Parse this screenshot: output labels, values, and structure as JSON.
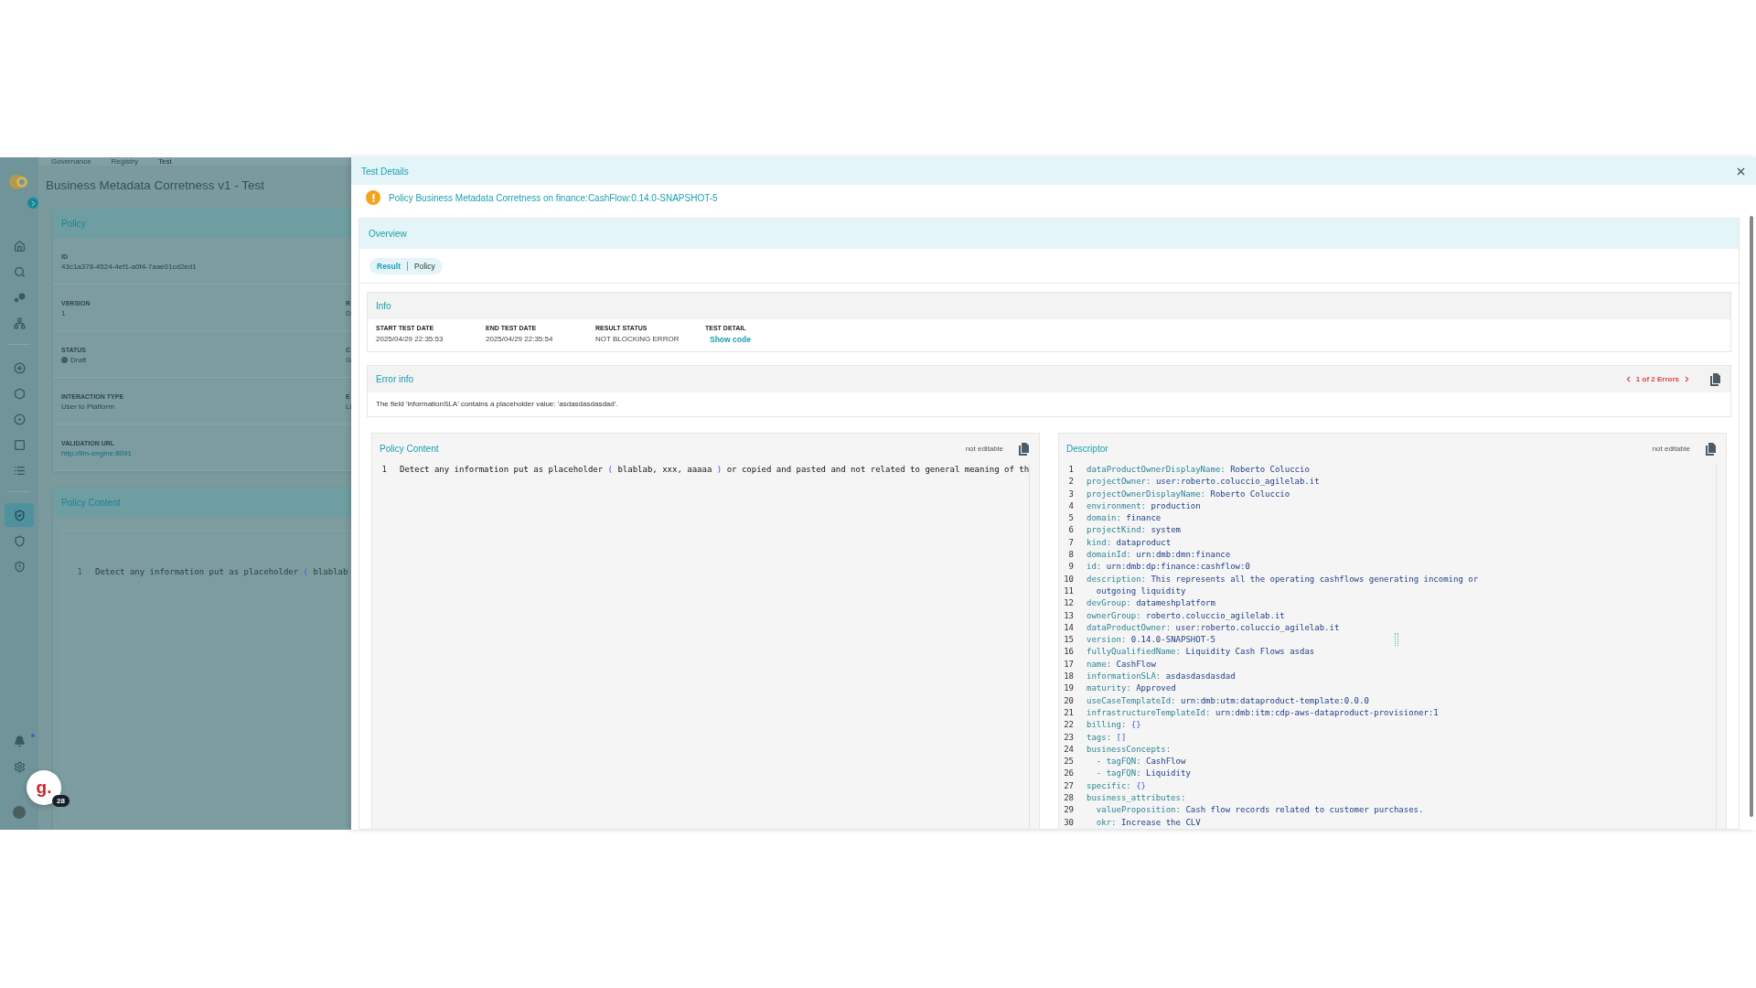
{
  "background_page": {
    "breadcrumbs": [
      "Governance",
      "Registry",
      "Test"
    ],
    "title": "Business Metadata Corretness v1 - Test",
    "policy_card": {
      "title": "Policy",
      "fields": [
        {
          "label": "ID",
          "value": "43c1a378-4524-4ef1-a0f4-7aae01cd2ed1",
          "kind": "text"
        },
        {
          "label": "VERSION",
          "value": "1",
          "kind": "text",
          "column_2_label": "R",
          "column_2_value": "D"
        },
        {
          "label": "STATUS",
          "value": "Draft",
          "kind": "status",
          "column_2_label": "C",
          "column_2_value": "G"
        },
        {
          "label": "INTERACTION TYPE",
          "value": "User to Platform",
          "kind": "text",
          "column_2_label": "E",
          "column_2_value": "Li"
        },
        {
          "label": "VALIDATION URL",
          "value": "http://llm-engine:8091",
          "kind": "link"
        }
      ]
    },
    "content_card": {
      "title": "Policy Content",
      "line_number": "1",
      "segments": [
        {
          "text": "Detect any information put as placeholder ",
          "kind": "text"
        },
        {
          "text": "(",
          "kind": "paren"
        },
        {
          "text": " blablab",
          "kind": "text"
        }
      ]
    }
  },
  "sidebar": {
    "items": [
      {
        "kind": "home",
        "selected": false
      },
      {
        "kind": "search",
        "selected": false
      },
      {
        "kind": "dots",
        "selected": false
      },
      {
        "kind": "network",
        "selected": false
      },
      {
        "kind": "hexagon-plus",
        "selected": false
      },
      {
        "kind": "hexagon",
        "selected": false
      },
      {
        "kind": "circle-dot",
        "selected": false
      },
      {
        "kind": "square",
        "selected": false
      },
      {
        "kind": "list",
        "selected": false
      },
      {
        "kind": "shield-check",
        "selected": true
      },
      {
        "kind": "shield",
        "selected": false
      },
      {
        "kind": "shield-alert",
        "selected": false
      }
    ]
  },
  "floating_badge": {
    "letter": "g.",
    "count": "28"
  },
  "drawer": {
    "title": "Test Details",
    "alert": "Policy Business Metadata Corretness on finance:CashFlow:0.14.0-SNAPSHOT-5",
    "overview": {
      "title": "Overview",
      "tabs": [
        {
          "label": "Result",
          "selected": true
        },
        {
          "label": "Policy",
          "selected": false
        }
      ]
    },
    "info": {
      "title": "Info",
      "columns": [
        {
          "label": "START TEST DATE",
          "value": "2025/04/29 22:35:53",
          "kind": "text"
        },
        {
          "label": "END TEST DATE",
          "value": "2025/04/29 22:35:54",
          "kind": "text"
        },
        {
          "label": "RESULT STATUS",
          "value": "NOT BLOCKING ERROR",
          "kind": "text"
        },
        {
          "label": "TEST DETAIL",
          "value": "Show code",
          "kind": "link"
        }
      ]
    },
    "error_info": {
      "title": "Error info",
      "pager": "1 of 2 Errors",
      "message": "The field 'informationSLA' contains a placeholder value: 'asdasdasdasdad'."
    },
    "policy_content": {
      "title": "Policy Content",
      "badge": "not editable",
      "lines": [
        {
          "number": "1",
          "segments": [
            {
              "text": "Detect any information put as placeholder ",
              "kind": "text"
            },
            {
              "text": "(",
              "kind": "paren"
            },
            {
              "text": " blablab, xxx, aaaaa ",
              "kind": "text"
            },
            {
              "text": ")",
              "kind": "paren"
            },
            {
              "text": " or copied and pasted and not related to general meaning of th",
              "kind": "text"
            }
          ]
        }
      ]
    },
    "descriptor": {
      "title": "Descriptor",
      "badge": "not editable",
      "lines": [
        {
          "number": "1",
          "key": "dataProductOwnerDisplayName:",
          "value": "Roberto Coluccio",
          "kind": "text"
        },
        {
          "number": "2",
          "key": "projectOwner:",
          "value": "user:roberto.coluccio_agilelab.it",
          "kind": "text"
        },
        {
          "number": "3",
          "key": "projectOwnerDisplayName:",
          "value": "Roberto Coluccio",
          "kind": "text"
        },
        {
          "number": "4",
          "key": "environment:",
          "value": "production",
          "kind": "text"
        },
        {
          "number": "5",
          "key": "domain:",
          "value": "finance",
          "kind": "text"
        },
        {
          "number": "6",
          "key": "projectKind:",
          "value": "system",
          "kind": "text"
        },
        {
          "number": "7",
          "key": "kind:",
          "value": "dataproduct",
          "kind": "text"
        },
        {
          "number": "8",
          "key": "domainId:",
          "value": "urn:dmb:dmn:finance",
          "kind": "text"
        },
        {
          "number": "9",
          "key": "id:",
          "value": "urn:dmb:dp:finance:cashflow:0",
          "kind": "text"
        },
        {
          "number": "10",
          "key": "description:",
          "value": "This represents all the operating cashflows generating incoming or",
          "kind": "text"
        },
        {
          "number": "11",
          "value": "  outgoing liquidity",
          "kind": "text"
        },
        {
          "number": "12",
          "key": "devGroup:",
          "value": "datameshplatform",
          "kind": "text"
        },
        {
          "number": "13",
          "key": "ownerGroup:",
          "value": "roberto.coluccio_agilelab.it",
          "kind": "text"
        },
        {
          "number": "14",
          "key": "dataProductOwner:",
          "value": "user:roberto.coluccio_agilelab.it",
          "kind": "text"
        },
        {
          "number": "15",
          "key": "version:",
          "value": "0.14.0-SNAPSHOT-5",
          "kind": "text"
        },
        {
          "number": "16",
          "key": "fullyQualifiedName:",
          "value": "Liquidity Cash Flows asdas",
          "kind": "text"
        },
        {
          "number": "17",
          "key": "name:",
          "value": "CashFlow",
          "kind": "text"
        },
        {
          "number": "18",
          "key": "informationSLA:",
          "value": "asdasdasdasdad",
          "kind": "text"
        },
        {
          "number": "19",
          "key": "maturity:",
          "value": "Approved",
          "kind": "text"
        },
        {
          "number": "20",
          "key": "useCaseTemplateId:",
          "value": "urn:dmb:utm:dataproduct-template:0.0.0",
          "kind": "text"
        },
        {
          "number": "21",
          "key": "infrastructureTemplateId:",
          "value": "urn:dmb:itm:cdp-aws-dataproduct-provisioner:1",
          "kind": "text"
        },
        {
          "number": "22",
          "key": "billing:",
          "value": "{}",
          "kind": "bracket"
        },
        {
          "number": "23",
          "key": "tags:",
          "value": "[]",
          "kind": "bracket"
        },
        {
          "number": "24",
          "key": "businessConcepts:"
        },
        {
          "number": "25",
          "key": "  - tagFQN:",
          "value": "CashFlow",
          "kind": "text"
        },
        {
          "number": "26",
          "key": "  - tagFQN:",
          "value": "Liquidity",
          "kind": "text"
        },
        {
          "number": "27",
          "key": "specific:",
          "value": "{}",
          "kind": "bracket"
        },
        {
          "number": "28",
          "key": "business_attributes:"
        },
        {
          "number": "29",
          "key": "  valueProposition:",
          "value": "Cash flow records related to customer purchases.",
          "kind": "text"
        },
        {
          "number": "30",
          "key": "  okr:",
          "value": "Increase the CLV",
          "kind": "text"
        }
      ]
    }
  }
}
